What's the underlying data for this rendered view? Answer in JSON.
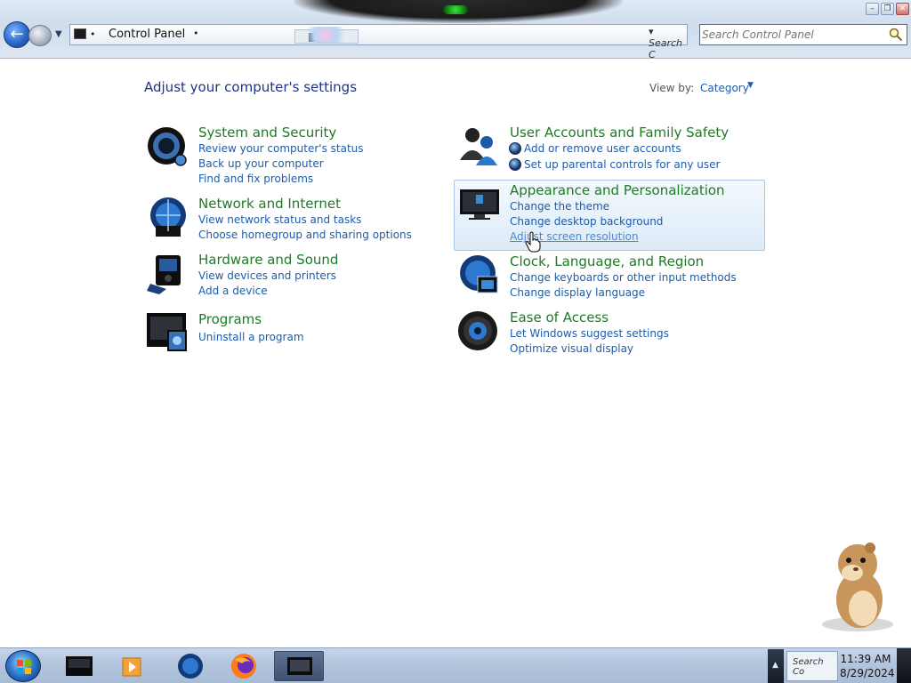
{
  "window": {
    "address": "Control Panel",
    "search_placeholder": "Search Control Panel",
    "addr_search_hint": "Search C"
  },
  "content": {
    "heading": "Adjust your computer's settings",
    "view_by_label": "View by:",
    "view_by_value": "Category"
  },
  "categories_left": [
    {
      "title": "System and Security",
      "links": [
        "Review your computer's status",
        "Back up your computer",
        "Find and fix problems"
      ],
      "icon": "system-security-icon"
    },
    {
      "title": "Network and Internet",
      "links": [
        "View network status and tasks",
        "Choose homegroup and sharing options"
      ],
      "icon": "network-globe-icon"
    },
    {
      "title": "Hardware and Sound",
      "links": [
        "View devices and printers",
        "Add a device"
      ],
      "icon": "hardware-sound-icon"
    },
    {
      "title": "Programs",
      "links": [
        "Uninstall a program"
      ],
      "icon": "programs-icon"
    }
  ],
  "categories_right": [
    {
      "title": "User Accounts and Family Safety",
      "links": [
        "Add or remove user accounts",
        "Set up parental controls for any user"
      ],
      "icon": "user-accounts-icon"
    },
    {
      "title": "Appearance and Personalization",
      "links": [
        "Change the theme",
        "Change desktop background",
        "Adjust screen resolution"
      ],
      "icon": "monitor-icon"
    },
    {
      "title": "Clock, Language, and Region",
      "links": [
        "Change keyboards or other input methods",
        "Change display language"
      ],
      "icon": "clock-globe-icon"
    },
    {
      "title": "Ease of Access",
      "links": [
        "Let Windows suggest settings",
        "Optimize visual display"
      ],
      "icon": "ease-of-access-icon"
    }
  ],
  "taskbar": {
    "time": "11:39 AM",
    "date": "8/29/2024",
    "tray_thumb_text": "Search Co",
    "items": [
      "explorer-icon",
      "media-player-icon",
      "globe-icon",
      "firefox-icon",
      "control-panel-icon"
    ]
  },
  "colors": {
    "category_title": "#1f7a26",
    "link": "#1e5ca8",
    "heading": "#1e3287"
  }
}
